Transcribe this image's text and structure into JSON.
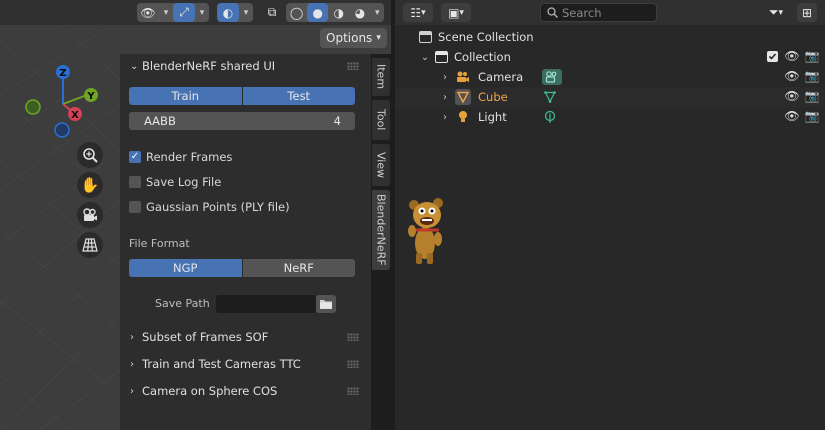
{
  "viewport": {
    "options_label": "Options",
    "gizmo": {
      "z": "Z",
      "y": "Y",
      "x": "X"
    }
  },
  "npanel": {
    "title": "BlenderNeRF shared UI",
    "mode_tabs": [
      "Train",
      "Test"
    ],
    "aabb": {
      "label": "AABB",
      "value": "4"
    },
    "checkboxes": [
      {
        "label": "Render Frames",
        "checked": true
      },
      {
        "label": "Save Log File",
        "checked": false
      },
      {
        "label": "Gaussian Points (PLY file)",
        "checked": false
      }
    ],
    "file_format_label": "File Format",
    "file_format_options": [
      "NGP",
      "NeRF"
    ],
    "save_path_label": "Save Path",
    "subpanels": [
      "Subset of Frames SOF",
      "Train and Test Cameras TTC",
      "Camera on Sphere COS"
    ]
  },
  "side_tabs": [
    "Item",
    "Tool",
    "View",
    "BlenderNeRF"
  ],
  "outliner": {
    "search_placeholder": "Search",
    "scene_collection": "Scene Collection",
    "collection": "Collection",
    "objects": [
      {
        "name": "Camera",
        "color": "#e0e0e0",
        "icon": "camera-icon"
      },
      {
        "name": "Cube",
        "color": "#f0a24a",
        "icon": "mesh-cube-icon"
      },
      {
        "name": "Light",
        "color": "#e0e0e0",
        "icon": "light-icon"
      }
    ]
  },
  "colors": {
    "accent": "#4772b3",
    "selected_text": "#f0a24a"
  }
}
